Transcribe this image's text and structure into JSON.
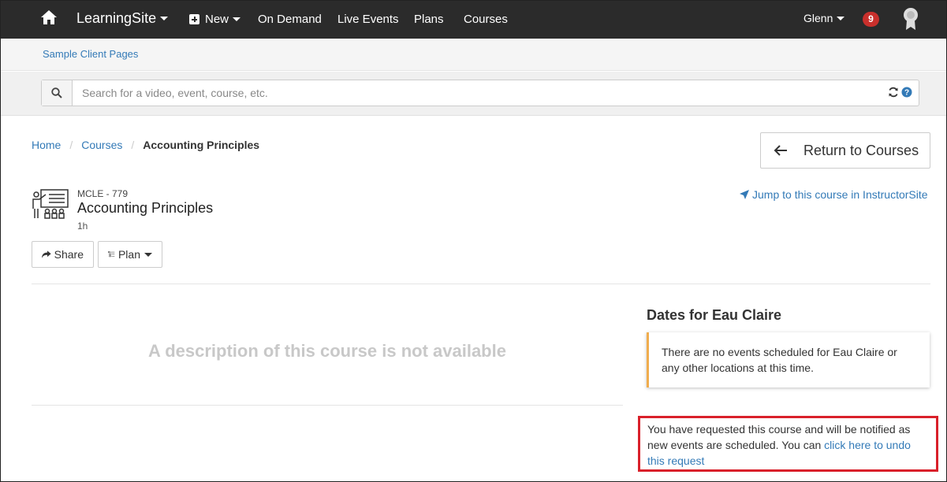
{
  "navbar": {
    "brand": "LearningSite",
    "new_label": "New",
    "items": [
      "On Demand",
      "Live Events",
      "Plans",
      "Courses"
    ],
    "user": "Glenn",
    "notification_count": "9"
  },
  "subnav": {
    "link": "Sample Client Pages"
  },
  "search": {
    "placeholder": "Search for a video, event, course, etc."
  },
  "breadcrumb": {
    "home": "Home",
    "courses": "Courses",
    "current": "Accounting Principles"
  },
  "return_button": "Return to Courses",
  "course": {
    "code": "MCLE - 779",
    "title": "Accounting Principles",
    "duration": "1h",
    "jump_link": "Jump to this course in InstructorSite"
  },
  "actions": {
    "share": "Share",
    "plan": "Plan"
  },
  "description_empty": "A description of this course is not available",
  "dates": {
    "heading": "Dates for Eau Claire",
    "no_events": "There are no events scheduled for Eau Claire or any other locations at this time."
  },
  "request": {
    "text": "You have requested this course and will be notified as new events are scheduled. You can ",
    "undo_link": "click here to undo this request"
  },
  "colors": {
    "navbar": "#2b2b2b",
    "link": "#337ab7",
    "badge": "#c9302c",
    "warning": "#f0ad4e",
    "highlight": "#d9202a"
  }
}
